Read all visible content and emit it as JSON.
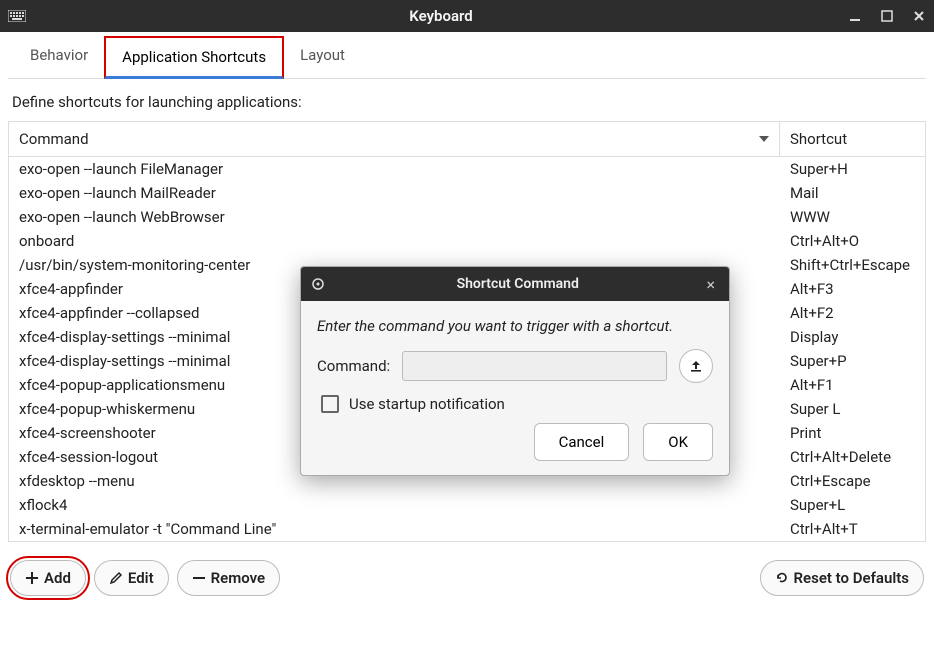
{
  "window": {
    "title": "Keyboard"
  },
  "tabs": {
    "behavior": "Behavior",
    "shortcuts": "Application Shortcuts",
    "layout": "Layout"
  },
  "subtitle": "Define shortcuts for launching applications:",
  "headers": {
    "command": "Command",
    "shortcut": "Shortcut"
  },
  "rows": [
    {
      "command": "exo-open --launch FileManager",
      "shortcut": "Super+H"
    },
    {
      "command": "exo-open --launch MailReader",
      "shortcut": "Mail"
    },
    {
      "command": "exo-open --launch WebBrowser",
      "shortcut": "WWW"
    },
    {
      "command": "onboard",
      "shortcut": "Ctrl+Alt+O"
    },
    {
      "command": "/usr/bin/system-monitoring-center",
      "shortcut": "Shift+Ctrl+Escape"
    },
    {
      "command": "xfce4-appfinder",
      "shortcut": "Alt+F3"
    },
    {
      "command": "xfce4-appfinder --collapsed",
      "shortcut": "Alt+F2"
    },
    {
      "command": "xfce4-display-settings --minimal",
      "shortcut": "Display"
    },
    {
      "command": "xfce4-display-settings --minimal",
      "shortcut": "Super+P"
    },
    {
      "command": "xfce4-popup-applicationsmenu",
      "shortcut": "Alt+F1"
    },
    {
      "command": "xfce4-popup-whiskermenu",
      "shortcut": "Super L"
    },
    {
      "command": "xfce4-screenshooter",
      "shortcut": "Print"
    },
    {
      "command": "xfce4-session-logout",
      "shortcut": "Ctrl+Alt+Delete"
    },
    {
      "command": "xfdesktop --menu",
      "shortcut": "Ctrl+Escape"
    },
    {
      "command": "xflock4",
      "shortcut": "Super+L"
    },
    {
      "command": "x-terminal-emulator -t \"Command Line\"",
      "shortcut": "Ctrl+Alt+T"
    }
  ],
  "buttons": {
    "add": "Add",
    "edit": "Edit",
    "remove": "Remove",
    "reset": "Reset to Defaults"
  },
  "modal": {
    "title": "Shortcut Command",
    "instruction": "Enter the command you want to trigger with a shortcut.",
    "command_label": "Command:",
    "command_value": "",
    "startup_label": "Use startup notification",
    "cancel": "Cancel",
    "ok": "OK"
  }
}
